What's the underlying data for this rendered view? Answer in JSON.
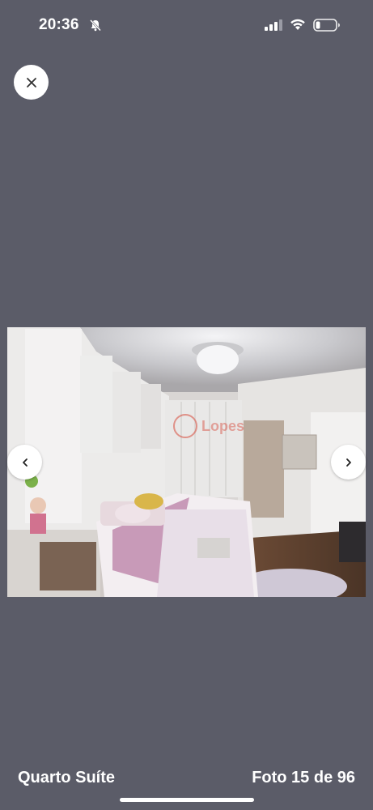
{
  "status_bar": {
    "time": "20:36",
    "icons": [
      "bell-slash-icon",
      "signal-icon",
      "wifi-icon",
      "battery-low-icon"
    ]
  },
  "viewer": {
    "close_icon": "close-icon",
    "prev_icon": "chevron-left-icon",
    "next_icon": "chevron-right-icon",
    "caption": "Quarto Suíte",
    "counter": "Foto 15 de 96",
    "watermark": "Lopes"
  },
  "colors": {
    "background": "#5b5c68",
    "button_bg": "#ffffff",
    "text": "#ffffff"
  }
}
